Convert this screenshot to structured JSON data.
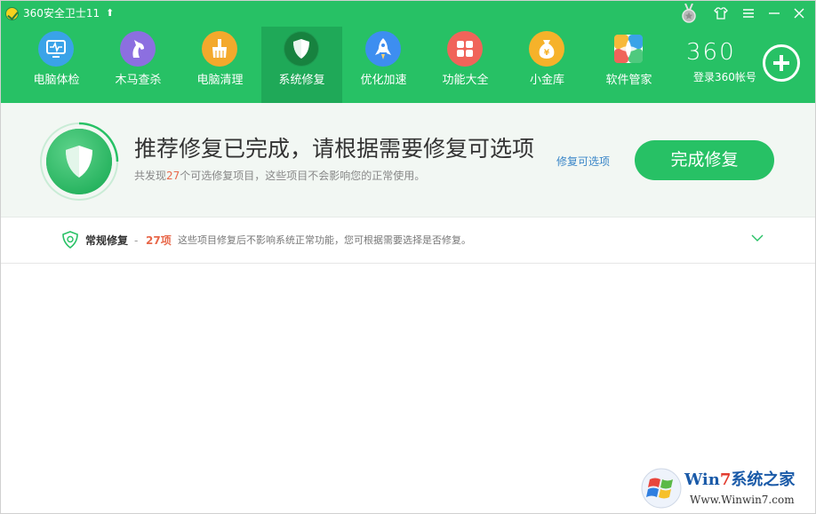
{
  "window": {
    "title": "360安全卫士11",
    "upgrade_icon": "up-arrow-icon",
    "controls": {
      "skin": "shirt-icon",
      "menu": "hamburger-menu-icon",
      "minimize": "minimize-icon",
      "close": "close-icon",
      "medal": "medal-icon"
    }
  },
  "nav": {
    "items": [
      {
        "label": "电脑体检",
        "icon": "monitor-checkup-icon",
        "color": "#3aa3e8"
      },
      {
        "label": "木马查杀",
        "icon": "trojan-horse-icon",
        "color": "#8c6fe0"
      },
      {
        "label": "电脑清理",
        "icon": "broom-icon",
        "color": "#f3a92c"
      },
      {
        "label": "系统修复",
        "icon": "shield-icon",
        "color": "#1f9a52",
        "active": true
      },
      {
        "label": "优化加速",
        "icon": "rocket-icon",
        "color": "#3d8ef0"
      },
      {
        "label": "功能大全",
        "icon": "apps-grid-icon",
        "color": "#f0645a"
      },
      {
        "label": "小金库",
        "icon": "money-bag-icon",
        "color": "#f6b22a"
      },
      {
        "label": "软件管家",
        "icon": "software-box-icon",
        "color": "#ffffff"
      }
    ],
    "brand": "360",
    "login_label": "登录360帐号",
    "add_icon": "plus-circle-icon"
  },
  "banner": {
    "heading": "推荐修复已完成，请根据需要修复可选项",
    "sub_prefix": "共发现",
    "sub_count": "27",
    "sub_suffix": "个可选修复项目，这些项目不会影响您的正常使用。",
    "optional_link": "修复可选项",
    "finish_button": "完成修复"
  },
  "section": {
    "title": "常规修复",
    "dash": "-",
    "count": "27项",
    "description": "这些项目修复后不影响系统正常功能，您可根据需要选择是否修复。",
    "toggle_icon": "chevron-down-icon"
  },
  "watermark": {
    "brand_left": "Win",
    "brand_num": "7",
    "brand_right": "系统之家",
    "url": "Www.Winwin7.com"
  },
  "colors": {
    "header_green": "#27c165",
    "active_tab": "#1fa958",
    "accent_orange": "#e8684a",
    "link_blue": "#3a86c8"
  }
}
